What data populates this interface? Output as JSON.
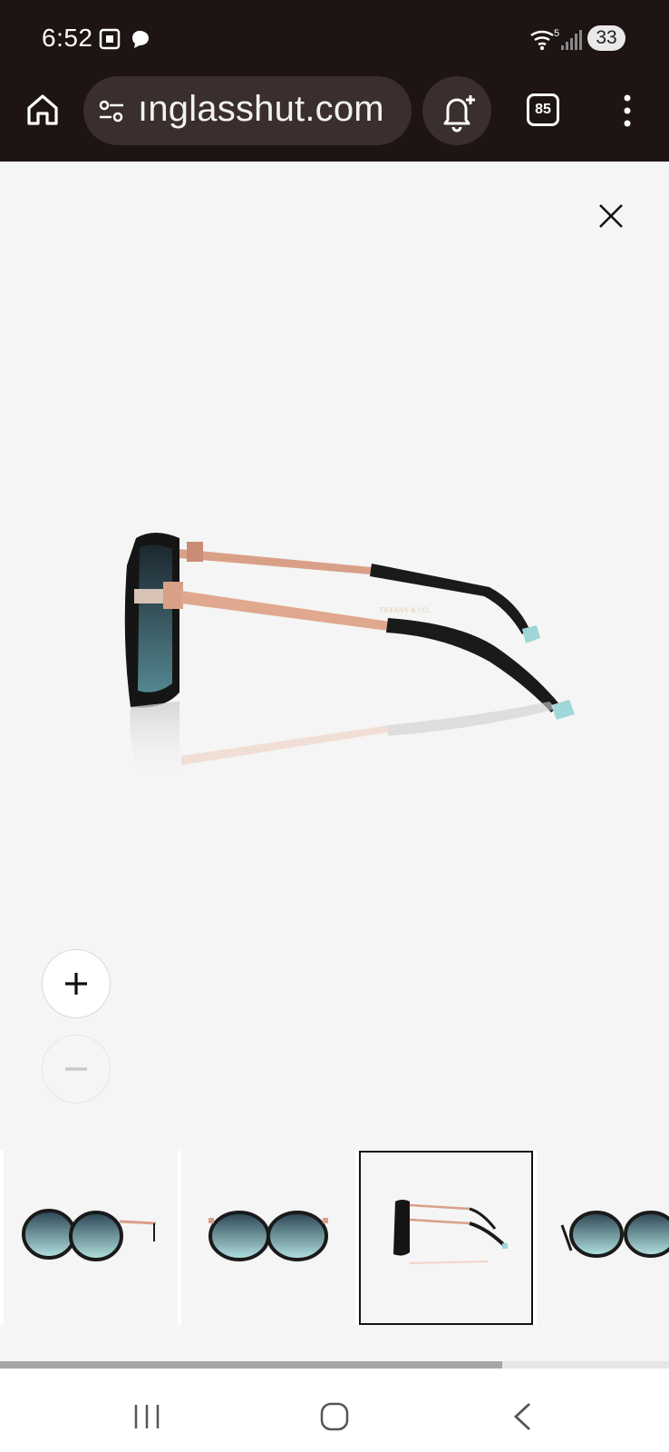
{
  "status_bar": {
    "time": "6:52",
    "battery": "33",
    "wifi_label": "5"
  },
  "browser": {
    "url": "ınglasshut.com",
    "tab_count": "85"
  },
  "viewer": {
    "zoom_in_label": "+",
    "zoom_out_label": "—",
    "product_logo_text": "TIFFANY & CO."
  },
  "thumbnails": {
    "selected_index": 2,
    "items": [
      {
        "view": "three-quarter-left"
      },
      {
        "view": "front"
      },
      {
        "view": "side"
      },
      {
        "view": "three-quarter-right"
      }
    ]
  },
  "gallery_scroll": {
    "position_fraction": 0.75
  },
  "colors": {
    "chrome_bg": "#1e1414",
    "frame_black": "#1a1a1a",
    "temple_rose_gold": "#d9a088",
    "tip_tiffany_blue": "#9fd6d8",
    "lens_gradient_top": "#2b4452",
    "lens_gradient_bottom": "#b4e3e2"
  }
}
